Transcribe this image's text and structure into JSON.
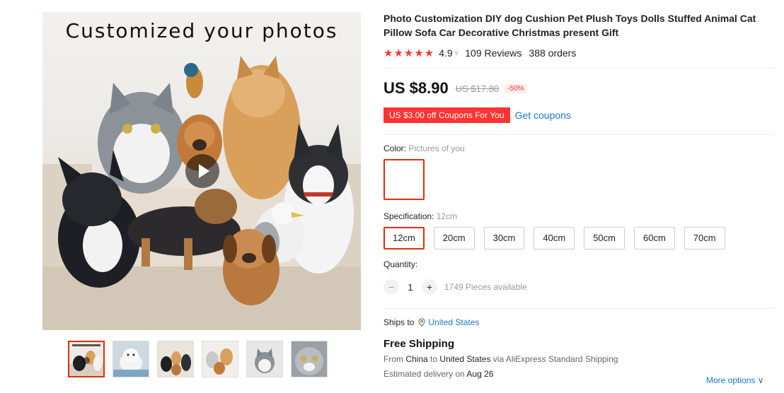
{
  "gallery": {
    "banner_text": "Customized your photos",
    "thumbnail_count": 6
  },
  "product": {
    "title": "Photo Customization DIY dog Cushion Pet Plush Toys Dolls Stuffed Animal Cat Pillow Sofa Car Decorative Christmas present Gift",
    "stars": "★★★★★",
    "rating": "4.9",
    "reviews": "109 Reviews",
    "orders": "388 orders"
  },
  "price": {
    "current": "US $8.90",
    "original": "US $17.80",
    "discount": "-50%"
  },
  "coupon": {
    "tag": "US $3.00 off Coupons For You",
    "link": "Get coupons"
  },
  "color": {
    "label": "Color:",
    "value": "Pictures of you"
  },
  "specification": {
    "label": "Specification:",
    "value": "12cm",
    "options": [
      "12cm",
      "20cm",
      "30cm",
      "40cm",
      "50cm",
      "60cm",
      "70cm"
    ],
    "selected_index": 0
  },
  "quantity": {
    "label": "Quantity:",
    "value": "1",
    "minus": "−",
    "plus": "+",
    "available": "1749 Pieces available"
  },
  "shipping": {
    "ships_to_label": "Ships to",
    "ships_to_value": "United States",
    "free_shipping": "Free Shipping",
    "from_prefix": "From",
    "from_country": "China",
    "to_word": "to",
    "to_country": "United States",
    "via": "via AliExpress Standard Shipping",
    "delivery_prefix": "Estimated delivery on",
    "delivery_date": "Aug 26",
    "more_options": "More options"
  },
  "colors": {
    "accent": "#e62e04",
    "star": "#ff3333",
    "link": "#1a76d2",
    "coupon_bg": "#ff3333"
  },
  "icons": {
    "chevron": "▿",
    "location_pin": "location-pin-icon",
    "more_chevron": "∨"
  }
}
